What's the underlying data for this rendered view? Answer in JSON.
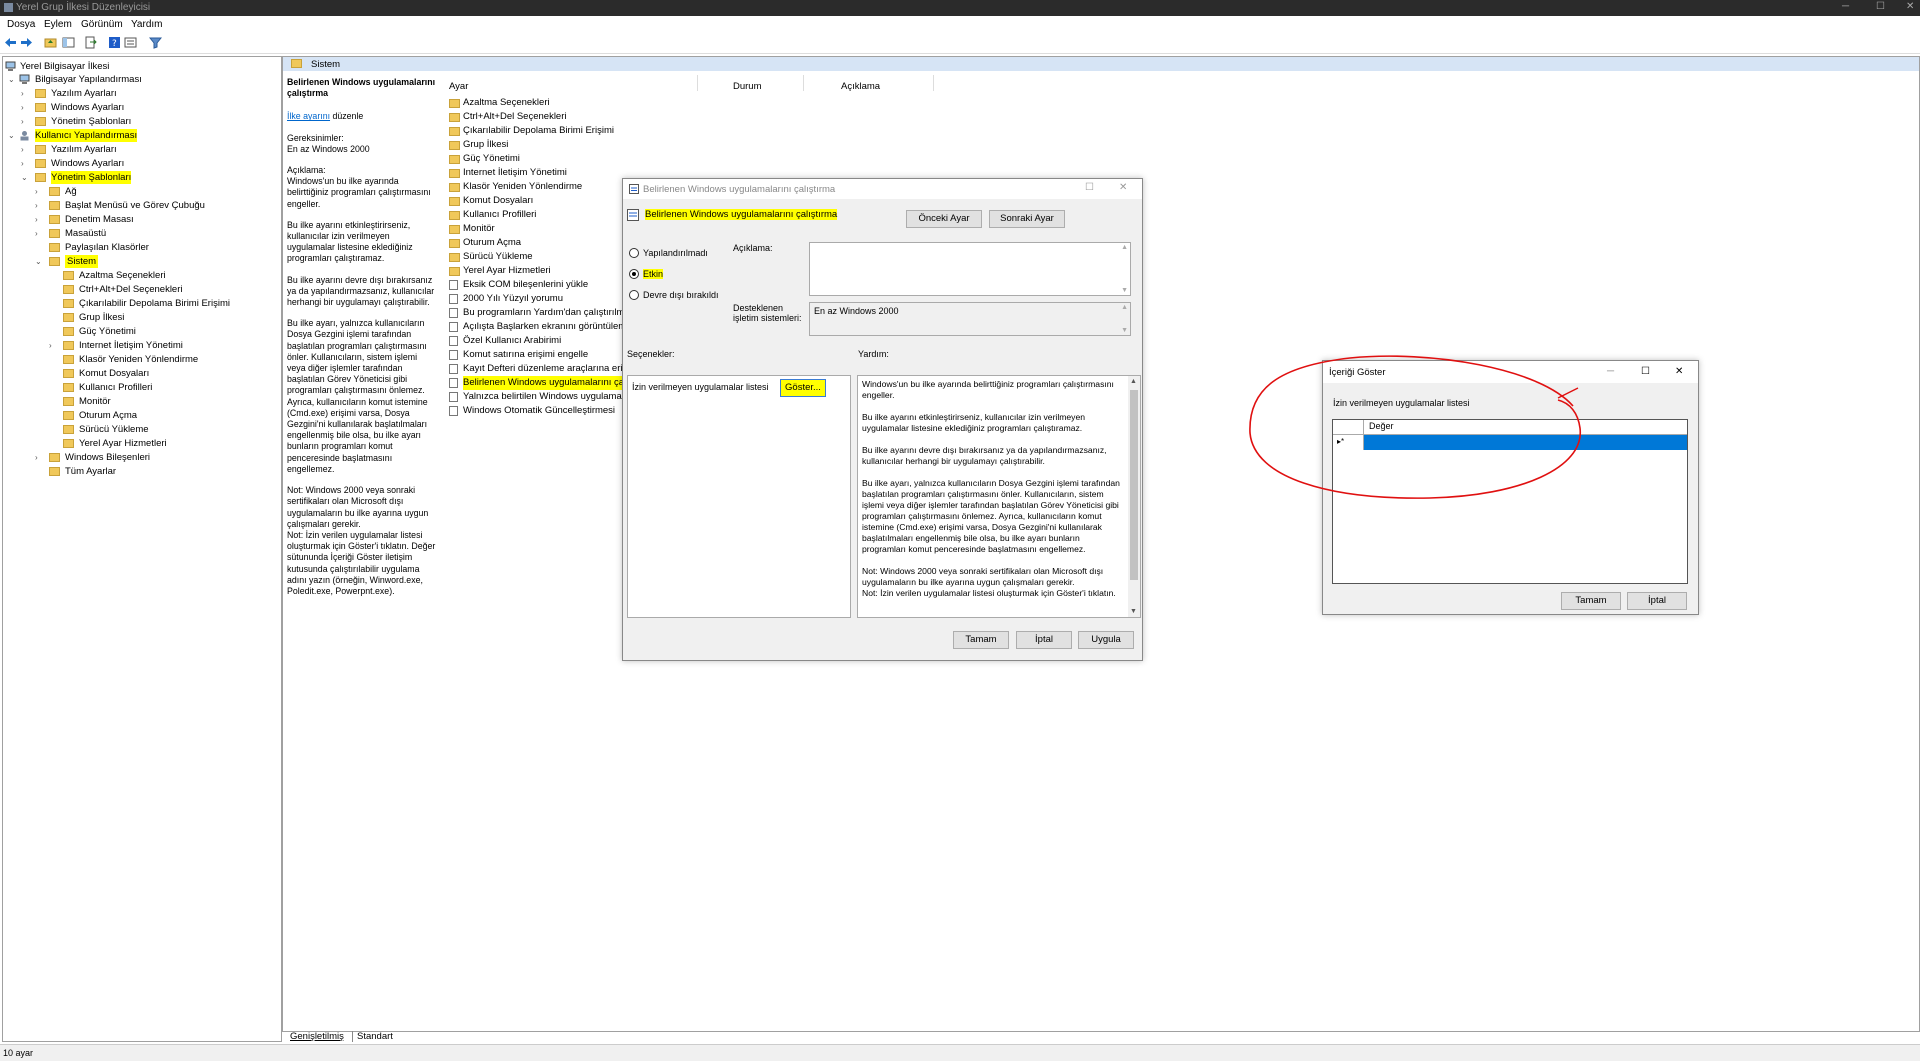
{
  "window": {
    "title": "Yerel Grup İlkesi Düzenleyicisi",
    "minimize": "─",
    "maximize": "☐",
    "close": "✕"
  },
  "menu": [
    "Dosya",
    "Eylem",
    "Görünüm",
    "Yardım"
  ],
  "tree": {
    "root": "Yerel Bilgisayar İlkesi",
    "computer_config": "Bilgisayar Yapılandırması",
    "cc_software": "Yazılım Ayarları",
    "cc_windows": "Windows Ayarları",
    "cc_admin": "Yönetim Şablonları",
    "user_config": "Kullanıcı Yapılandırması",
    "uc_software": "Yazılım Ayarları",
    "uc_windows": "Windows Ayarları",
    "uc_admin": "Yönetim Şablonları",
    "ag": "Ağ",
    "start_menu": "Başlat Menüsü ve Görev Çubuğu",
    "control_panel": "Denetim Masası",
    "desktop": "Masaüstü",
    "shared_folders": "Paylaşılan Klasörler",
    "system": "Sistem",
    "system_children": [
      "Azaltma Seçenekleri",
      "Ctrl+Alt+Del Seçenekleri",
      "Çıkarılabilir Depolama Birimi Erişimi",
      "Grup İlkesi",
      "Güç Yönetimi",
      "Internet İletişim Yönetimi",
      "Klasör Yeniden Yönlendirme",
      "Komut Dosyaları",
      "Kullanıcı Profilleri",
      "Monitör",
      "Oturum Açma",
      "Sürücü Yükleme",
      "Yerel Ayar Hizmetleri"
    ],
    "windows_components": "Windows Bileşenleri",
    "all_settings": "Tüm Ayarlar"
  },
  "rightpane": {
    "header": "Sistem",
    "desc_title": "Belirlenen Windows uygulamalarını çalıştırma",
    "edit_link": "İlke ayarını",
    "edit_suffix": " düzenle",
    "req_label": "Gereksinimler:",
    "req_value": "En az Windows 2000",
    "desc_label": "Açıklama:",
    "desc_p1": "Windows'un bu ilke ayarında belirttiğiniz programları çalıştırmasını engeller.",
    "desc_p2": "Bu ilke ayarını etkinleştirirseniz, kullanıcılar izin verilmeyen uygulamalar listesine eklediğiniz programları çalıştıramaz.",
    "desc_p3": "Bu ilke ayarını devre dışı bırakırsanız ya da yapılandırmazsanız, kullanıcılar herhangi bir uygulamayı çalıştırabilir.",
    "desc_p4": "Bu ilke ayarı, yalnızca kullanıcıların Dosya Gezgini işlemi tarafından başlatılan programları çalıştırmasını önler. Kullanıcıların, sistem işlemi veya diğer işlemler tarafından başlatılan Görev Yöneticisi gibi programları çalıştırmasını önlemez. Ayrıca, kullanıcıların komut istemine (Cmd.exe) erişimi varsa, Dosya Gezgini'ni kullanılarak başlatılmaları engellenmiş bile olsa, bu ilke ayarı bunların programları komut penceresinde başlatmasını engellemez.",
    "desc_p5": "Not: Windows 2000 veya sonraki sertifikaları olan Microsoft dışı uygulamaların bu ilke ayarına uygun çalışmaları gerekir.\nNot: İzin verilen uygulamalar listesi oluşturmak için Göster'i tıklatın. Değer sütununda İçeriği Göster iletişim kutusunda çalıştırılabilir uygulama adını yazın (örneğin, Winword.exe, Poledit.exe, Powerpnt.exe).",
    "col_setting": "Ayar",
    "col_state": "Durum",
    "col_comment": "Açıklama",
    "folders": [
      "Azaltma Seçenekleri",
      "Ctrl+Alt+Del Seçenekleri",
      "Çıkarılabilir Depolama Birimi Erişimi",
      "Grup İlkesi",
      "Güç Yönetimi",
      "Internet İletişim Yönetimi",
      "Klasör Yeniden Yönlendirme",
      "Komut Dosyaları",
      "Kullanıcı Profilleri",
      "Monitör",
      "Oturum Açma",
      "Sürücü Yükleme",
      "Yerel Ayar Hizmetleri"
    ],
    "policies": [
      "Eksik COM bileşenlerini yükle",
      "2000 Yılı Yüzyıl yorumu",
      "Bu programların Yardım'dan çalıştırılmas",
      "Açılışta Başlarken ekranını görüntüleme",
      "Özel Kullanıcı Arabirimi",
      "Komut satırına erişimi engelle",
      "Kayıt Defteri düzenleme araçlarına erişim",
      "Belirlenen Windows uygulamalarını çalıştı",
      "Yalnızca belirtilen Windows uygulamaları",
      "Windows Otomatik Güncelleştirmesi"
    ]
  },
  "dialog1": {
    "title": "Belirlenen Windows uygulamalarını çalıştırma",
    "heading": "Belirlenen Windows uygulamalarını çalıştırma",
    "prev": "Önceki Ayar",
    "next": "Sonraki Ayar",
    "not_configured": "Yapılandırılmadı",
    "enabled": "Etkin",
    "disabled": "Devre dışı bırakıldı",
    "comment_label": "Açıklama:",
    "supported_label": "Desteklenen işletim sistemleri:",
    "supported_value": "En az Windows 2000",
    "options_label": "Seçenekler:",
    "help_label": "Yardım:",
    "option_text": "İzin verilmeyen uygulamalar listesi",
    "show_btn": "Göster...",
    "help_p1": "Windows'un bu ilke ayarında belirttiğiniz programları çalıştırmasını engeller.",
    "help_p2": "Bu ilke ayarını etkinleştirirseniz, kullanıcılar izin verilmeyen uygulamalar listesine eklediğiniz programları çalıştıramaz.",
    "help_p3": "Bu ilke ayarını devre dışı bırakırsanız ya da yapılandırmazsanız, kullanıcılar herhangi bir uygulamayı çalıştırabilir.",
    "help_p4": "Bu ilke ayarı, yalnızca kullanıcıların Dosya Gezgini işlemi tarafından başlatılan programları çalıştırmasını önler. Kullanıcıların, sistem işlemi veya diğer işlemler tarafından başlatılan Görev Yöneticisi gibi programları çalıştırmasını önlemez.  Ayrıca, kullanıcıların komut istemine (Cmd.exe) erişimi varsa, Dosya Gezgini'ni kullanılarak başlatılmaları engellenmiş bile olsa, bu ilke ayarı bunların programları komut penceresinde başlatmasını engellemez.",
    "help_p5": "Not: Windows 2000 veya sonraki sertifikaları olan Microsoft dışı uygulamaların bu ilke ayarına uygun çalışmaları gerekir.\nNot: İzin verilen uygulamalar listesi oluşturmak için Göster'i tıklatın.",
    "ok": "Tamam",
    "cancel": "İptal",
    "apply": "Uygula"
  },
  "dialog2": {
    "title": "İçeriği Göster",
    "label": "İzin verilmeyen uygulamalar listesi",
    "col_value": "Değer",
    "row_marker": "▸*",
    "ok": "Tamam",
    "cancel": "İptal"
  },
  "tabs": [
    "Genişletilmiş",
    "Standart"
  ],
  "status": "10 ayar",
  "colors": {
    "highlight": "#ffff00",
    "selection": "#0078d7",
    "annotation": "#e01010"
  }
}
